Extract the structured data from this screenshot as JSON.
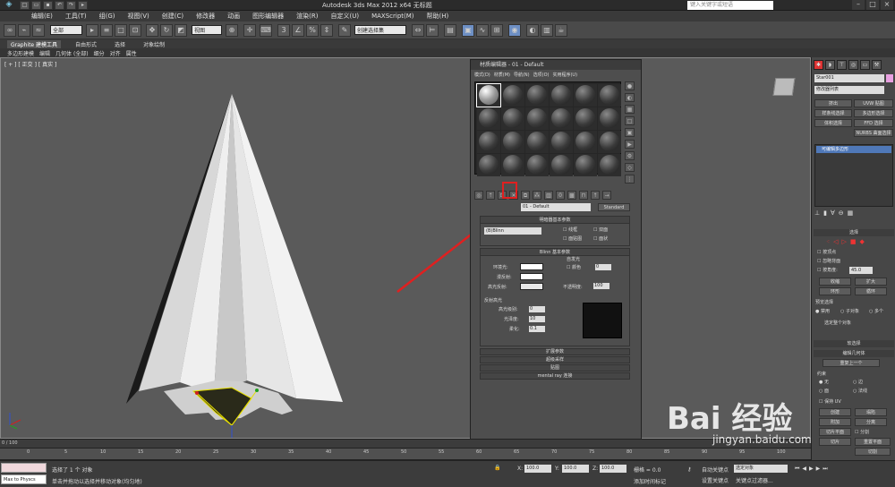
{
  "app": {
    "title": "Autodesk 3ds Max  2012 x64     无标题",
    "search_placeholder": "键入关键字或短语"
  },
  "menu": [
    "编辑(E)",
    "工具(T)",
    "组(G)",
    "视图(V)",
    "创建(C)",
    "修改器",
    "动画",
    "图形编辑器",
    "渲染(R)",
    "自定义(U)",
    "MAXScript(M)",
    "帮助(H)"
  ],
  "toolbar": {
    "selection_filter": "全部",
    "coord_system": "视图",
    "named_sel": "创建选择集"
  },
  "ribbon": {
    "tabs": [
      "Graphite 建模工具",
      "自由形式",
      "选择",
      "对象绘制"
    ],
    "sub": [
      "多边形建模",
      "编辑",
      "几何体 (全部)",
      "细分",
      "对齐",
      "属性"
    ]
  },
  "viewport": {
    "label": "[ + ] [ 正交 ] [ 真实 ]"
  },
  "material_editor": {
    "title": "材质编辑器 - 01 - Default",
    "menu": [
      "模式(D)",
      "材质(M)",
      "导航(N)",
      "选项(O)",
      "实用程序(U)"
    ],
    "slot_count": 24,
    "material_name": "01 - Default",
    "material_type": "Standard",
    "shader_rollout": "明暗器基本参数",
    "shader": "(B)Blinn",
    "options": [
      "线框",
      "双面",
      "面贴图",
      "面状"
    ],
    "blinn_rollout": "Blinn 基本参数",
    "self_illum": "自发光",
    "color_label": "颜色",
    "self_illum_val": "0",
    "ambient": "环境光:",
    "diffuse": "漫反射:",
    "specular": "高光反射:",
    "opacity_label": "不透明度:",
    "opacity_val": "100",
    "highlight_group": "反射高光",
    "spec_level": "高光级别:",
    "spec_level_val": "0",
    "glossiness": "光泽度:",
    "glossiness_val": "10",
    "soften": "柔化:",
    "soften_val": "0.1",
    "rollouts": [
      "扩展参数",
      "超级采样",
      "贴图",
      "mental ray 连接"
    ]
  },
  "command_panel": {
    "object_name": "Star001",
    "modifier_list": "修改器列表",
    "buttons": [
      "挤出",
      "UVW 贴图",
      "样条线选择",
      "多边形选择",
      "体积选择",
      "FFD 选择",
      "NURBS 曲面选择"
    ],
    "stack_item": "可编辑多边形",
    "selection_head": "选择",
    "by_vertex": "按顶点",
    "ignore_back": "忽略背面",
    "by_angle": "按角度:",
    "angle_val": "45.0",
    "shrink": "收缩",
    "grow": "扩大",
    "ring": "环形",
    "loop": "循环",
    "preview": "预览选择",
    "disabled": "禁用",
    "sub_object": "子对象",
    "multi": "多个",
    "selected_entire": "选定整个对象",
    "soft_sel": "软选择",
    "edit_geo": "编辑几何体",
    "repeat_last": "重复上一个",
    "constraints": "约束",
    "none": "无",
    "edge": "边",
    "face": "面",
    "normal": "法线",
    "keep_uv": "保持 UV",
    "create": "创建",
    "collapse": "塌陷",
    "attach": "附加",
    "separate": "分离",
    "slice_plane": "切片平面",
    "split": "分割",
    "slice": "切片",
    "reset_plane": "重置平面",
    "cut": "切割"
  },
  "timeline": {
    "position": "0 / 100",
    "ticks": [
      "0",
      "5",
      "10",
      "15",
      "20",
      "25",
      "30",
      "35",
      "40",
      "45",
      "50",
      "55",
      "60",
      "65",
      "70",
      "75",
      "80",
      "85",
      "90",
      "95",
      "100"
    ]
  },
  "status": {
    "maxscript": "Max to Physcs ",
    "selected": "选择了 1 个 对象",
    "prompt": "单击并拖动以选择并移动对象(均匀地)",
    "x_label": "X:",
    "x_val": "100.0",
    "y_label": "Y:",
    "y_val": "100.0",
    "z_label": "Z:",
    "z_val": "100.0",
    "grid": "栅格 = 0.0",
    "auto_key": "自动关键点",
    "set_key": "设置关键点",
    "selected_obj": "选定对象",
    "key_filters": "关键点过滤器...",
    "add_time_tag": "添加时间标记"
  },
  "watermark": {
    "brand": "Bai 经验",
    "url": "jingyan.baidu.com"
  }
}
